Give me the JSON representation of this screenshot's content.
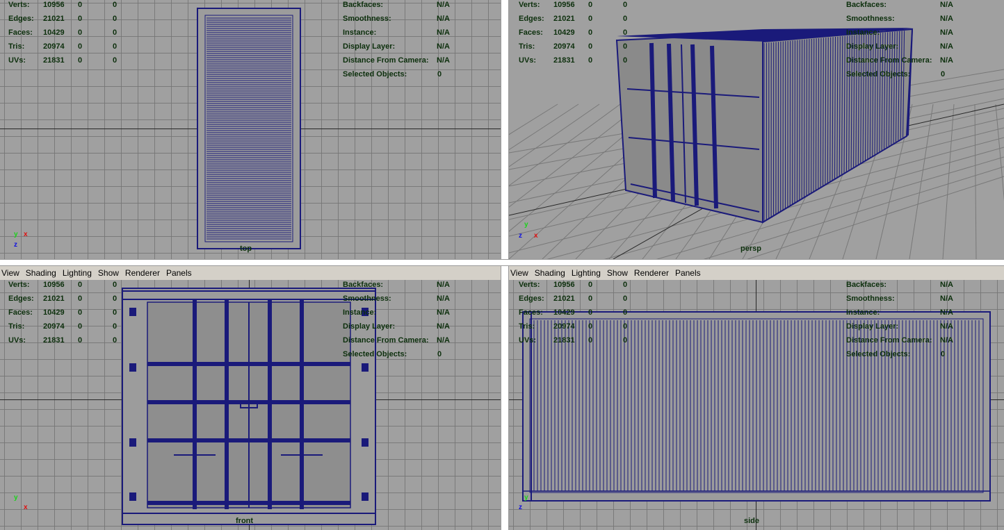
{
  "menu": [
    "View",
    "Shading",
    "Lighting",
    "Show",
    "Renderer",
    "Panels"
  ],
  "stats_left": [
    {
      "label": "Verts:",
      "v1": "10956",
      "v2": "0",
      "v3": "0"
    },
    {
      "label": "Edges:",
      "v1": "21021",
      "v2": "0",
      "v3": "0"
    },
    {
      "label": "Faces:",
      "v1": "10429",
      "v2": "0",
      "v3": "0"
    },
    {
      "label": "Tris:",
      "v1": "20974",
      "v2": "0",
      "v3": "0"
    },
    {
      "label": "UVs:",
      "v1": "21831",
      "v2": "0",
      "v3": "0"
    }
  ],
  "stats_right": [
    {
      "label": "Backfaces:",
      "value": "N/A"
    },
    {
      "label": "Smoothness:",
      "value": "N/A"
    },
    {
      "label": "Instance:",
      "value": "N/A"
    },
    {
      "label": "Display Layer:",
      "value": "N/A"
    },
    {
      "label": "Distance From Camera:",
      "value": "N/A"
    },
    {
      "label": "Selected Objects:",
      "value": "0"
    }
  ],
  "viewports": {
    "top": {
      "label": "top"
    },
    "persp": {
      "label": "persp"
    },
    "front": {
      "label": "front"
    },
    "side": {
      "label": "side"
    }
  },
  "gizmo": {
    "x": "x",
    "y": "y",
    "z": "z"
  },
  "colors": {
    "wire": "#1a1a7a",
    "viewport_bg": "#a0a0a0",
    "grid": "#767676",
    "hud_text": "#0c2f0c"
  }
}
